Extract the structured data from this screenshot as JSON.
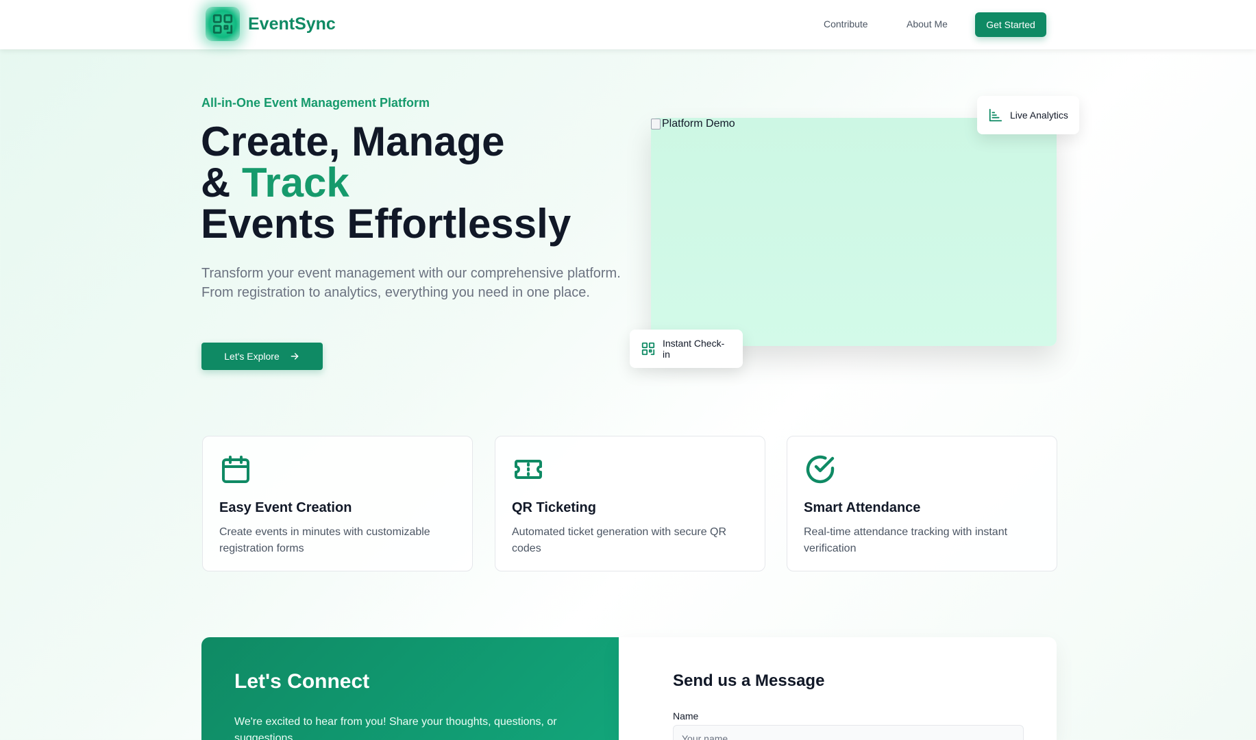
{
  "brand": {
    "name": "EventSync"
  },
  "nav": {
    "links": [
      "Contribute",
      "About Me"
    ],
    "cta": "Get Started"
  },
  "hero": {
    "eyebrow": "All-in-One Event Management Platform",
    "title_line1": "Create, Manage",
    "title_line2_prefix": "& ",
    "title_line2_accent": "Track",
    "title_line3": "Events Effortlessly",
    "description": "Transform your event management with our comprehensive platform. From registration to analytics, everything you need in one place.",
    "cta": "Let's Explore",
    "demo_alt": "Platform Demo",
    "badge_analytics": "Live Analytics",
    "badge_checkin": "Instant Check-in"
  },
  "features": [
    {
      "icon": "calendar-icon",
      "title": "Easy Event Creation",
      "desc": "Create events in minutes with customizable registration forms"
    },
    {
      "icon": "ticket-icon",
      "title": "QR Ticketing",
      "desc": "Automated ticket generation with secure QR codes"
    },
    {
      "icon": "check-circle-icon",
      "title": "Smart Attendance",
      "desc": "Real-time attendance tracking with instant verification"
    }
  ],
  "contact": {
    "title": "Let's Connect",
    "description": "We're excited to hear from you! Share your thoughts, questions, or suggestions.",
    "form_title": "Send us a Message",
    "name_label": "Name",
    "name_placeholder": "Your name"
  },
  "colors": {
    "accent": "#0f8a64",
    "accent_light": "#169a6c"
  }
}
